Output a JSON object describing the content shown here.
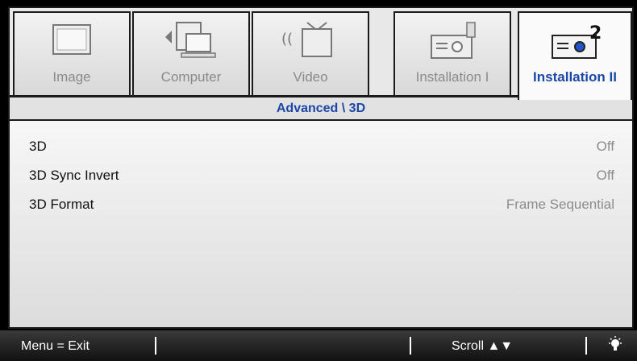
{
  "tabs": [
    {
      "label": "Image",
      "icon": "monitor-icon",
      "active": false
    },
    {
      "label": "Computer",
      "icon": "computer-icon",
      "active": false
    },
    {
      "label": "Video",
      "icon": "video-icon",
      "active": false
    },
    {
      "label": "Installation I",
      "icon": "projector-icon",
      "active": false
    },
    {
      "label": "Installation II",
      "icon": "projector-2-icon",
      "active": true
    }
  ],
  "breadcrumb": "Advanced \\ 3D",
  "settings": [
    {
      "name": "3D",
      "value": "Off"
    },
    {
      "name": "3D Sync Invert",
      "value": "Off"
    },
    {
      "name": "3D Format",
      "value": "Frame Sequential"
    }
  ],
  "footer": {
    "menu_hint": "Menu = Exit",
    "scroll_hint": "Scroll ▲▼",
    "lamp_icon": "lamp-icon"
  },
  "colors": {
    "accent": "#1a47a8",
    "inactive_text": "#8a8a8a",
    "value_text": "#8c8c8c"
  }
}
